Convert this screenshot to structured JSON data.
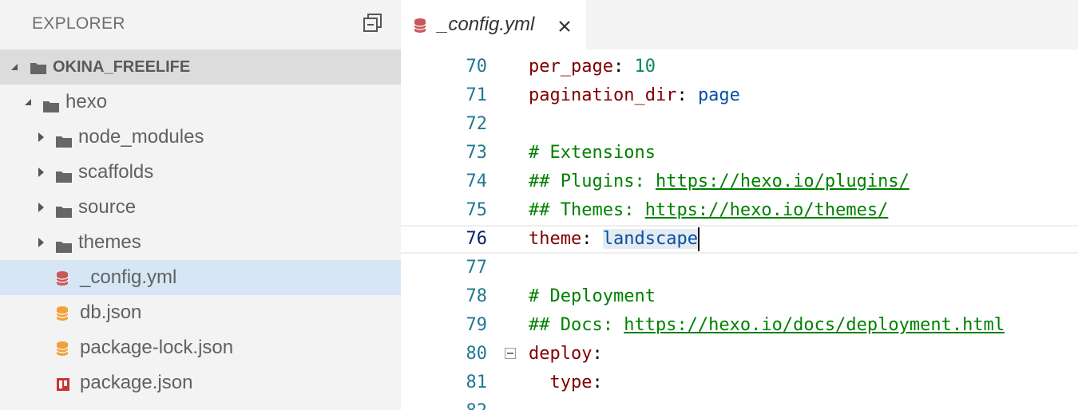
{
  "sidebar": {
    "title": "EXPLORER",
    "root": "OKINA_FREELIFE",
    "items": [
      {
        "label": "hexo",
        "kind": "folder",
        "expanded": true,
        "depth": 1
      },
      {
        "label": "node_modules",
        "kind": "folder",
        "expanded": false,
        "depth": 2
      },
      {
        "label": "scaffolds",
        "kind": "folder",
        "expanded": false,
        "depth": 2
      },
      {
        "label": "source",
        "kind": "folder",
        "expanded": false,
        "depth": 2
      },
      {
        "label": "themes",
        "kind": "folder",
        "expanded": false,
        "depth": 2
      },
      {
        "label": "_config.yml",
        "kind": "yaml",
        "selected": true,
        "depth": 2
      },
      {
        "label": "db.json",
        "kind": "json",
        "depth": 2
      },
      {
        "label": "package-lock.json",
        "kind": "json",
        "depth": 2
      },
      {
        "label": "package.json",
        "kind": "npm",
        "depth": 2
      }
    ]
  },
  "editor": {
    "tab_label": "_config.yml",
    "active_line": "76",
    "lines": [
      {
        "num": "70",
        "tokens": [
          [
            "k",
            "per_page"
          ],
          [
            "p",
            ": "
          ],
          [
            "n",
            "10"
          ]
        ]
      },
      {
        "num": "71",
        "tokens": [
          [
            "k",
            "pagination_dir"
          ],
          [
            "p",
            ": "
          ],
          [
            "s",
            "page"
          ]
        ]
      },
      {
        "num": "72",
        "tokens": []
      },
      {
        "num": "73",
        "tokens": [
          [
            "c",
            "# Extensions"
          ]
        ]
      },
      {
        "num": "74",
        "tokens": [
          [
            "c",
            "## Plugins: "
          ],
          [
            "u",
            "https://hexo.io/plugins/"
          ]
        ]
      },
      {
        "num": "75",
        "tokens": [
          [
            "c",
            "## Themes: "
          ],
          [
            "u",
            "https://hexo.io/themes/"
          ]
        ]
      },
      {
        "num": "76",
        "tokens": [
          [
            "k",
            "theme"
          ],
          [
            "p",
            ": "
          ],
          [
            "s sel",
            "landscape"
          ],
          [
            "cursor",
            ""
          ]
        ]
      },
      {
        "num": "77",
        "tokens": []
      },
      {
        "num": "78",
        "tokens": [
          [
            "c",
            "# Deployment"
          ]
        ]
      },
      {
        "num": "79",
        "tokens": [
          [
            "c",
            "## Docs: "
          ],
          [
            "u",
            "https://hexo.io/docs/deployment.html"
          ]
        ]
      },
      {
        "num": "80",
        "tokens": [
          [
            "k",
            "deploy"
          ],
          [
            "p",
            ":"
          ]
        ],
        "foldable": true
      },
      {
        "num": "81",
        "tokens": [
          [
            "p",
            "  "
          ],
          [
            "k",
            "type"
          ],
          [
            "p",
            ":"
          ]
        ]
      },
      {
        "num": "82",
        "tokens": []
      }
    ]
  },
  "colors": {
    "key": "#800000",
    "number": "#09885a",
    "string": "#0451a5",
    "comment": "#008000",
    "line_number": "#237893",
    "selected_row": "#d6e6f5"
  }
}
